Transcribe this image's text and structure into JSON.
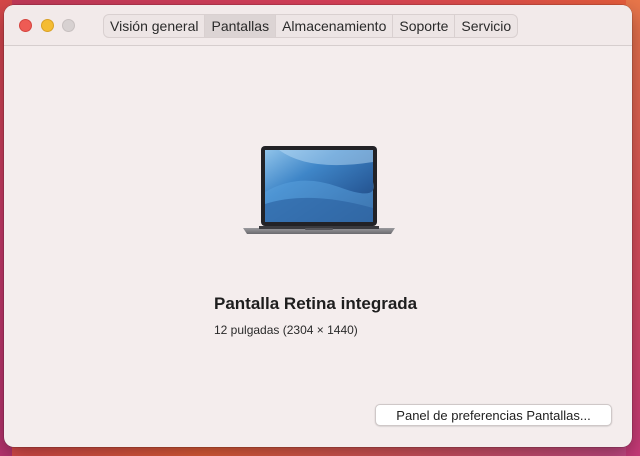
{
  "tabs": [
    {
      "label": "Visión general",
      "selected": false
    },
    {
      "label": "Pantallas",
      "selected": true
    },
    {
      "label": "Almacenamiento",
      "selected": false
    },
    {
      "label": "Soporte",
      "selected": false
    },
    {
      "label": "Servicio",
      "selected": false
    }
  ],
  "display": {
    "name": "Pantalla Retina integrada",
    "detail": "12 pulgadas (2304 × 1440)",
    "image_icon": "laptop-icon"
  },
  "actions": {
    "prefs_button_label": "Panel de preferencias Pantallas..."
  },
  "colors": {
    "close": "#ee5b54",
    "minimize": "#f4bc33",
    "zoom_disabled": "#d7d1d1",
    "window_bg": "#f4eded"
  }
}
